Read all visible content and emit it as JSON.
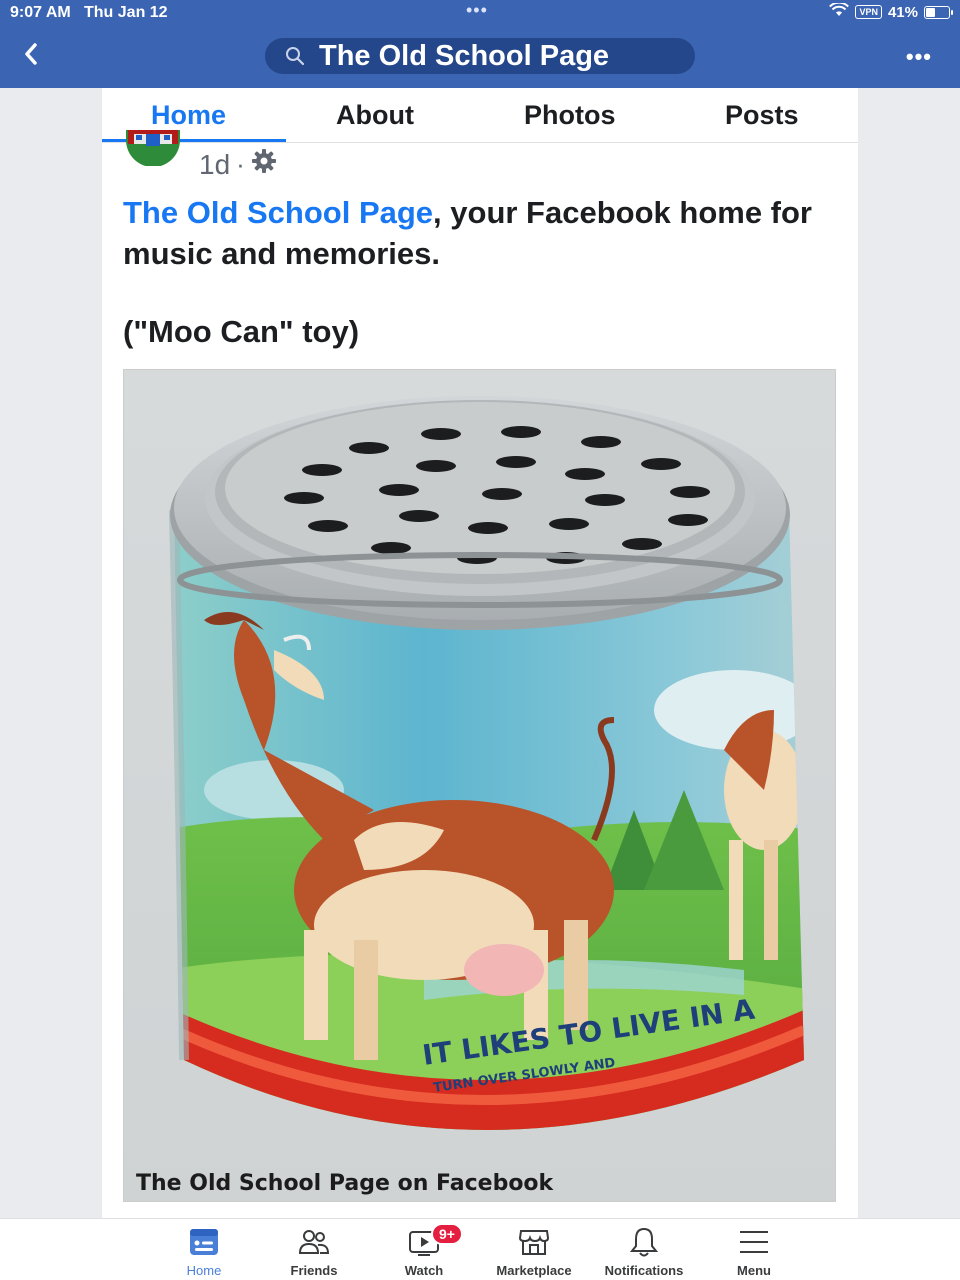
{
  "status": {
    "time": "9:07 AM",
    "date": "Thu Jan 12",
    "dots": "•••",
    "vpn": "VPN",
    "battery": "41%",
    "battery_level": 0.41
  },
  "nav": {
    "search_title": "The Old School Page",
    "more": "•••"
  },
  "tabs": [
    {
      "label": "Home",
      "active": true
    },
    {
      "label": "About"
    },
    {
      "label": "Photos"
    },
    {
      "label": "Posts"
    }
  ],
  "post": {
    "time": "1d",
    "separator": "·",
    "page_name": "The Old School Page",
    "text_rest": ", your Facebook home for music and memories.",
    "caption": "(\"Moo Can\" toy)",
    "image": {
      "can_slogan": "IT LIKES TO LIVE IN A",
      "can_subtext": "TURN OVER SLOWLY AND",
      "watermark": "The Old School Page on Facebook"
    }
  },
  "bottom_nav": [
    {
      "label": "Home",
      "icon": "home-icon",
      "active": true
    },
    {
      "label": "Friends",
      "icon": "friends-icon"
    },
    {
      "label": "Watch",
      "icon": "watch-icon",
      "badge": "9+"
    },
    {
      "label": "Marketplace",
      "icon": "marketplace-icon"
    },
    {
      "label": "Notifications",
      "icon": "bell-icon"
    },
    {
      "label": "Menu",
      "icon": "menu-icon"
    }
  ],
  "colors": {
    "brand_bar": "#3b64b3",
    "accent": "#1877f2",
    "badge": "#e41e3f"
  }
}
